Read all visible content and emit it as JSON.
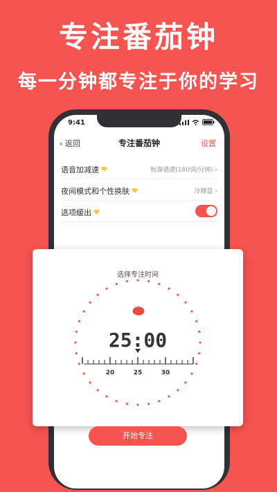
{
  "headline": {
    "title": "专注番茄钟",
    "subtitle": "每一分钟都专注于你的学习"
  },
  "status": {
    "time": "9:41"
  },
  "nav": {
    "back": "返回",
    "title": "专注番茄钟",
    "settings": "设置"
  },
  "settings": [
    {
      "label": "语音加减速",
      "value": "标准语速(180词/分钟)"
    },
    {
      "label": "夜间模式和个性换肤",
      "value": "冷静蓝"
    },
    {
      "label": "选项缓出",
      "toggle": true
    }
  ],
  "timer_card": {
    "title": "选择专注时间",
    "time": "25:00",
    "ticks": [
      "20",
      "25",
      "30"
    ]
  },
  "start_button": "开始专注",
  "colors": {
    "accent": "#f65450",
    "gem": "#f7c948",
    "phone": "#2f3136"
  }
}
